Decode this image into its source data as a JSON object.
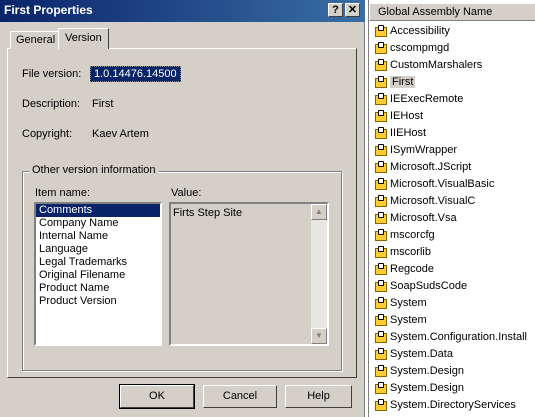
{
  "dialog": {
    "title": "First Properties",
    "help_glyph": "?",
    "close_glyph": "✕",
    "tabs": [
      "General",
      "Version"
    ],
    "file_version_label": "File version:",
    "file_version_value": "1.0.14476.14500",
    "description_label": "Description:",
    "description_value": "First",
    "copyright_label": "Copyright:",
    "copyright_value": "Kaev Artem",
    "group_title": "Other version information",
    "item_name_label": "Item name:",
    "value_label": "Value:",
    "items": [
      "Comments",
      "Company Name",
      "Internal Name",
      "Language",
      "Legal Trademarks",
      "Original Filename",
      "Product Name",
      "Product Version"
    ],
    "selected_item": "Comments",
    "value_text": "Firts Step Site",
    "ok_label": "OK",
    "cancel_label": "Cancel",
    "help_label": "Help"
  },
  "gac": {
    "header": "Global Assembly Name",
    "selected": "First",
    "assemblies": [
      "Accessibility",
      "cscompmgd",
      "CustomMarshalers",
      "First",
      "IEExecRemote",
      "IEHost",
      "IIEHost",
      "ISymWrapper",
      "Microsoft.JScript",
      "Microsoft.VisualBasic",
      "Microsoft.VisualC",
      "Microsoft.Vsa",
      "mscorcfg",
      "mscorlib",
      "Regcode",
      "SoapSudsCode",
      "System",
      "System",
      "System.Configuration.Install",
      "System.Data",
      "System.Design",
      "System.Design",
      "System.DirectoryServices"
    ]
  }
}
